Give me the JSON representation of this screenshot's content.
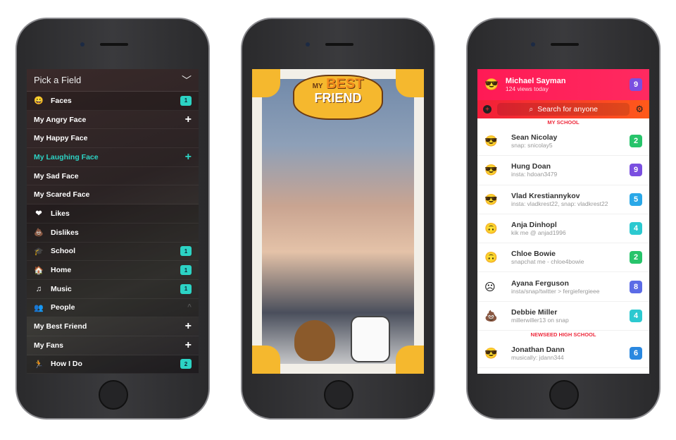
{
  "field_picker": {
    "title": "Pick a Field",
    "rows": [
      {
        "label": "Faces",
        "icon": "😀",
        "type": "cat",
        "badge": "1"
      },
      {
        "label": "My Angry Face",
        "type": "sub",
        "action": "+"
      },
      {
        "label": "My Happy Face",
        "type": "sub"
      },
      {
        "label": "My Laughing Face",
        "type": "sub",
        "action": "+",
        "highlight": true
      },
      {
        "label": "My Sad Face",
        "type": "sub"
      },
      {
        "label": "My Scared Face",
        "type": "sub"
      },
      {
        "label": "Likes",
        "icon": "❤",
        "type": "cat"
      },
      {
        "label": "Dislikes",
        "icon": "💩",
        "type": "cat"
      },
      {
        "label": "School",
        "icon": "🎓",
        "type": "cat",
        "badge": "1"
      },
      {
        "label": "Home",
        "icon": "🏠",
        "type": "cat",
        "badge": "1"
      },
      {
        "label": "Music",
        "icon": "♫",
        "type": "cat",
        "badge": "1"
      },
      {
        "label": "People",
        "icon": "👥",
        "type": "cat",
        "action": "^"
      },
      {
        "label": "My Best Friend",
        "type": "sub",
        "action": "+"
      },
      {
        "label": "My Fans",
        "type": "sub",
        "action": "+"
      },
      {
        "label": "How I Do",
        "icon": "🏃",
        "type": "cat",
        "badge": "2"
      }
    ]
  },
  "camera": {
    "sticker_top": "MY",
    "sticker_mid": "BEST",
    "sticker_bottom": "FRIEND"
  },
  "profile_list": {
    "user": {
      "name": "Michael Sayman",
      "views": "124 views today",
      "badge": "9",
      "emoji": "😎"
    },
    "search_placeholder": "Search for anyone",
    "sections": [
      {
        "title": "MY SCHOOL",
        "people": [
          {
            "name": "Sean Nicolay",
            "sub": "snap: snicolay5",
            "emoji": "😎",
            "badge": "2",
            "color": "#27c46b"
          },
          {
            "name": "Hung Doan",
            "sub": "insta: hdoan3479",
            "emoji": "😎",
            "badge": "9",
            "color": "#7a4fe0"
          },
          {
            "name": "Vlad Krestiannykov",
            "sub": "insta: vladkrest22, snap: vladkrest22",
            "emoji": "😎",
            "badge": "5",
            "color": "#2aa8e8"
          },
          {
            "name": "Anja Dinhopl",
            "sub": "kik me @ anjad1996",
            "emoji": "🙃",
            "badge": "4",
            "color": "#2cc9d0"
          },
          {
            "name": "Chloe Bowie",
            "sub": "snapchat me - chloe4bowie",
            "emoji": "🙃",
            "badge": "2",
            "color": "#27c46b"
          },
          {
            "name": "Ayana Ferguson",
            "sub": "insta/snap/twitter > fergiefergieee",
            "emoji": "☹",
            "badge": "8",
            "color": "#5b6be6"
          },
          {
            "name": "Debbie Miller",
            "sub": "millerwiller13 on snap",
            "emoji": "💩",
            "badge": "4",
            "color": "#2cc9d0"
          }
        ]
      },
      {
        "title": "NEWSEED HIGH SCHOOL",
        "people": [
          {
            "name": "Jonathan Dann",
            "sub": "musically: jdann344",
            "emoji": "😎",
            "badge": "6",
            "color": "#2a88e0"
          }
        ]
      }
    ]
  }
}
